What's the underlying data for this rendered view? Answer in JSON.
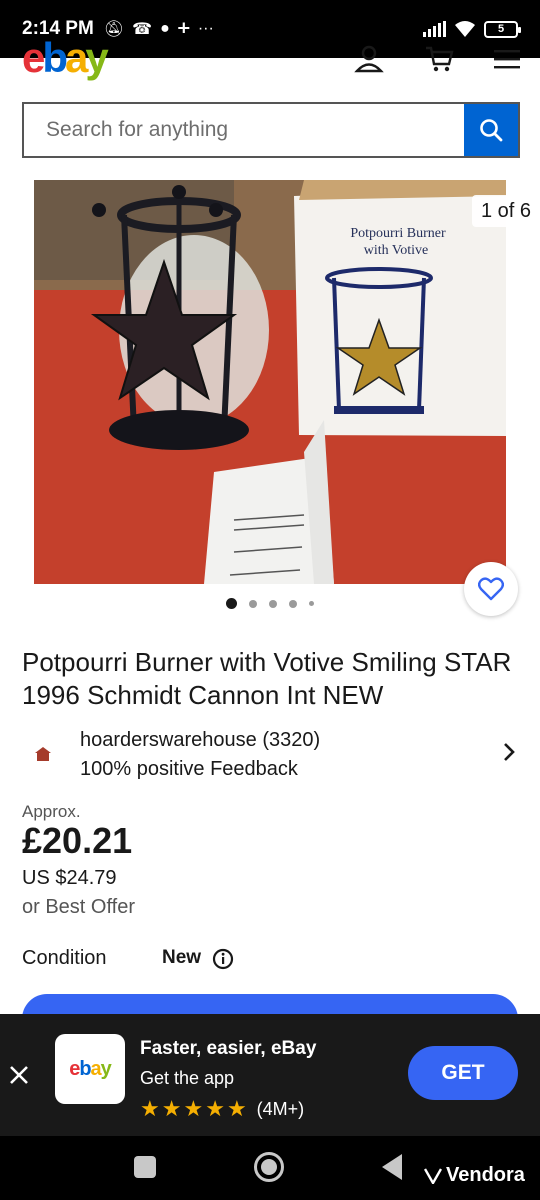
{
  "status_bar": {
    "time": "2:14 PM",
    "icons": [
      "mute-icon",
      "missed-call-icon",
      "chat-icon",
      "plus-icon",
      "more-dots"
    ],
    "battery": "5"
  },
  "header": {
    "logo": [
      "e",
      "b",
      "a",
      "y"
    ],
    "icons": [
      "profile-icon",
      "cart-icon",
      "menu-icon"
    ]
  },
  "search": {
    "placeholder": "Search for anything"
  },
  "gallery": {
    "counter": "1 of 6",
    "dots": 5,
    "active": 0
  },
  "box_print": {
    "line1": "Potpourri Burner",
    "line2": "with Votive"
  },
  "listing": {
    "title": "Potpourri Burner with Votive Smiling STAR 1996 Schmidt Cannon Int NEW",
    "seller_name": "hoarderswarehouse (3320)",
    "seller_feedback": "100% positive Feedback",
    "approx_label": "Approx.",
    "price": "£20.21",
    "price_usd": "US $24.79",
    "best_offer": "or Best Offer",
    "condition_label": "Condition",
    "condition_value": "New"
  },
  "app_banner": {
    "logo": [
      "e",
      "b",
      "a",
      "y"
    ],
    "title": "Faster, easier, eBay",
    "subtitle": "Get the app",
    "rating_count": "(4M+)",
    "button": "GET"
  },
  "navbar": {
    "brand": "Vendora"
  },
  "colors": {
    "ebay_red": "#e53238",
    "ebay_blue": "#0064d2",
    "ebay_yellow": "#f5af02",
    "ebay_green": "#86b817",
    "cta_blue": "#3665f3"
  }
}
